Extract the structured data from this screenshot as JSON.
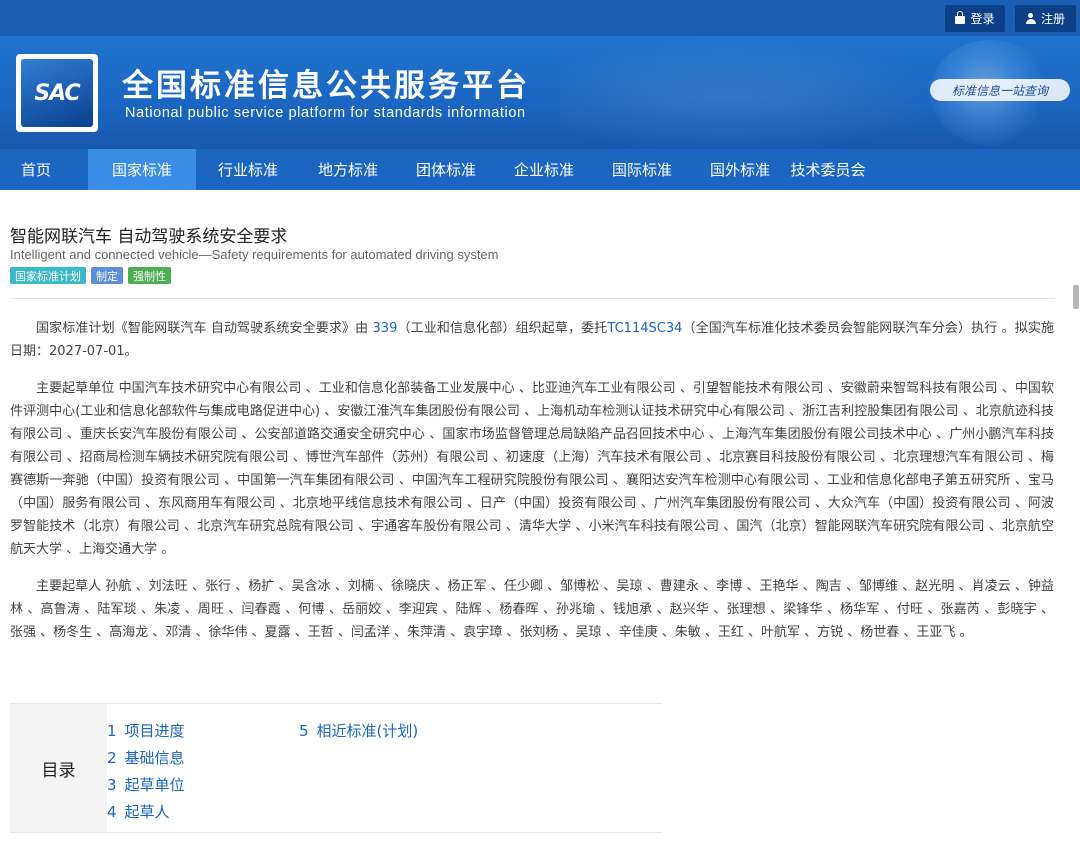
{
  "topbar": {
    "login_label": "登录",
    "register_label": "注册"
  },
  "banner": {
    "logo_text": "SAC",
    "title_cn": "全国标准信息公共服务平台",
    "title_en": "National public service platform  for standards information",
    "slogan": "标准信息一站查询"
  },
  "nav": {
    "items": [
      {
        "label": "首页"
      },
      {
        "label": "国家标准"
      },
      {
        "label": "行业标准"
      },
      {
        "label": "地方标准"
      },
      {
        "label": "团体标准"
      },
      {
        "label": "企业标准"
      },
      {
        "label": "国际标准"
      },
      {
        "label": "国外标准"
      },
      {
        "label": "技术委员会"
      }
    ],
    "active_index": 1
  },
  "document": {
    "title_cn": "智能网联汽车 自动驾驶系统安全要求",
    "title_en": "Intelligent and connected vehicle—Safety requirements for automated driving system",
    "tags": [
      "国家标准计划",
      "制定",
      "强制性"
    ],
    "plan": {
      "text_before": "国家标准计划《智能网联汽车 自动驾驶系统安全要求》由 ",
      "dept_code": "339",
      "text_middle": "（工业和信息化部）组织起草，委托",
      "tc_code": "TC114SC34",
      "text_after": "（全国汽车标准化技术委员会智能网联汽车分会）执行 。拟实施日期：2027-07-01。"
    },
    "drafting_units": "主要起草单位 中国汽车技术研究中心有限公司 、工业和信息化部装备工业发展中心 、比亚迪汽车工业有限公司 、引望智能技术有限公司 、安徽蔚来智驾科技有限公司 、中国软件评测中心(工业和信息化部软件与集成电路促进中心) 、安徽江淮汽车集团股份有限公司 、上海机动车检测认证技术研究中心有限公司 、浙江吉利控股集团有限公司 、北京航迹科技有限公司 、重庆长安汽车股份有限公司 、公安部道路交通安全研究中心 、国家市场监督管理总局缺陷产品召回技术中心 、上海汽车集团股份有限公司技术中心 、广州小鹏汽车科技有限公司 、招商局检测车辆技术研究院有限公司 、博世汽车部件（苏州）有限公司 、初速度（上海）汽车技术有限公司 、北京赛目科技股份有限公司 、北京理想汽车有限公司 、梅赛德斯一奔驰（中国）投资有限公司 、中国第一汽车集团有限公司 、中国汽车工程研究院股份有限公司 、襄阳达安汽车检测中心有限公司 、工业和信息化部电子第五研究所 、宝马（中国）服务有限公司 、东风商用车有限公司 、北京地平线信息技术有限公司 、日产（中国）投资有限公司 、广州汽车集团股份有限公司 、大众汽车（中国）投资有限公司 、阿波罗智能技术（北京）有限公司 、北京汽车研究总院有限公司 、宇通客车股份有限公司 、清华大学 、小米汽车科技有限公司 、国汽（北京）智能网联汽车研究院有限公司 、北京航空航天大学 、上海交通大学 。",
    "drafters": "主要起草人 孙航 、刘法旺 、张行 、杨扩 、吴含冰 、刘楠 、徐晓庆 、杨正军 、任少卿 、邹博松 、吴琼 、曹建永 、李博 、王艳华 、陶吉 、邹博维 、赵光明 、肖凌云 、钟益林 、高鲁涛 、陆军琰 、朱凌 、周旺 、闫春霞 、何博 、岳丽姣 、李迎宾 、陆辉 、杨春晖 、孙兆瑜 、钱旭承 、赵兴华 、张理想 、梁锋华 、杨华军 、付旺 、张嘉芮 、彭晓宇 、张强 、杨冬生 、高海龙 、邓清 、徐华伟 、夏露 、王哲 、闫孟洋 、朱萍清 、袁宇璋 、张刘杨 、吴琼 、辛佳庚 、朱敏 、王红 、叶航军 、方锐 、杨世春 、王亚飞 。"
  },
  "toc": {
    "label": "目录",
    "items": [
      {
        "num": "1",
        "label": "项目进度"
      },
      {
        "num": "2",
        "label": "基础信息"
      },
      {
        "num": "3",
        "label": "起草单位"
      },
      {
        "num": "4",
        "label": "起草人"
      },
      {
        "num": "5",
        "label": "相近标准(计划)"
      }
    ]
  }
}
